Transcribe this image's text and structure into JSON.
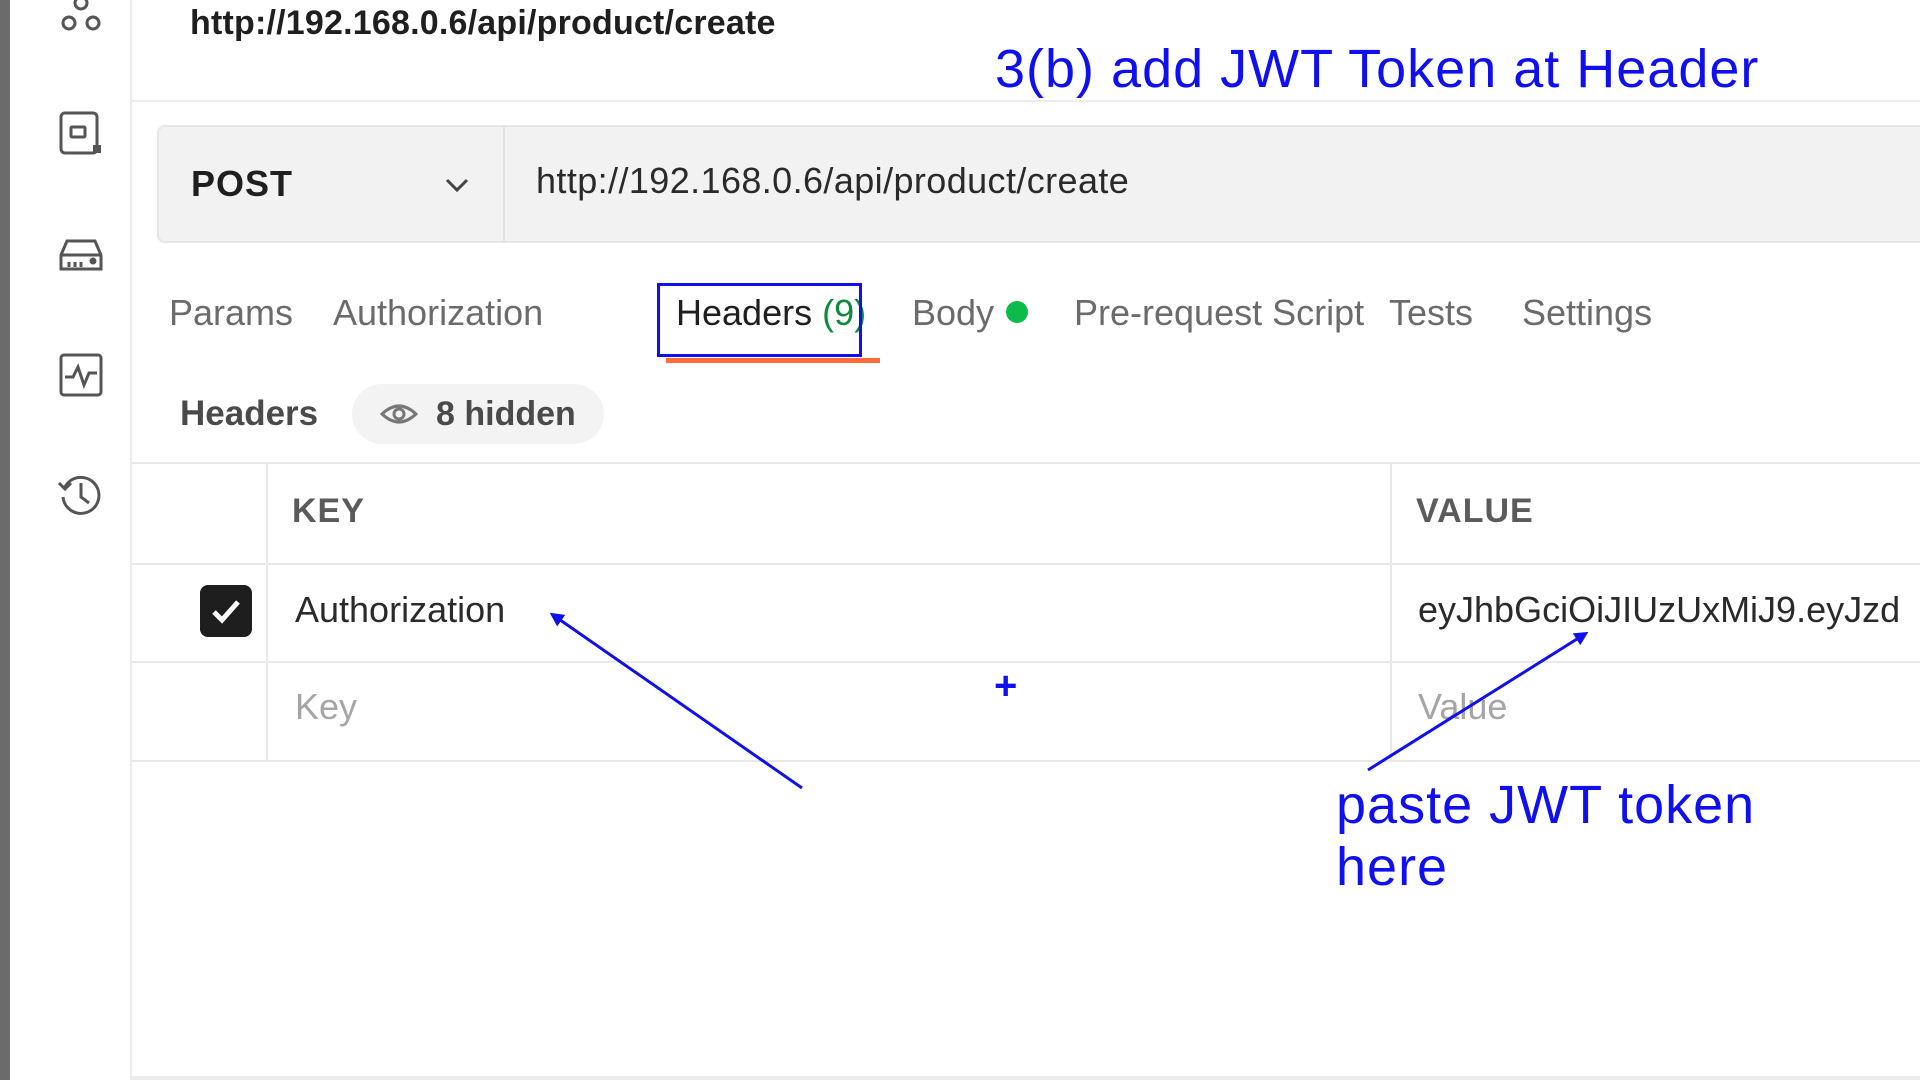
{
  "request": {
    "title": "http://192.168.0.6/api/product/create",
    "method": "POST",
    "url": "http://192.168.0.6/api/product/create"
  },
  "tabs": {
    "params": "Params",
    "authorization": "Authorization",
    "headers": "Headers",
    "headers_count": "(9)",
    "body": "Body",
    "pre_request": "Pre-request Script",
    "tests": "Tests",
    "settings": "Settings"
  },
  "headers_panel": {
    "label": "Headers",
    "hidden": "8 hidden",
    "col_key": "KEY",
    "col_value": "VALUE",
    "rows": [
      {
        "key": "Authorization",
        "value": "eyJhbGciOiJIUzUxMiJ9.eyJzd",
        "checked": true
      }
    ],
    "new_key_placeholder": "Key",
    "new_value_placeholder": "Value"
  },
  "annotations": {
    "title": "3(b) add JWT Token at Header",
    "plus": "+",
    "paste_line1": "paste JWT token",
    "paste_line2": "here",
    "color": "#1010ee"
  },
  "colors": {
    "active_tab_underline": "#ff6c37",
    "headers_count": "#0b8a3e",
    "body_dot": "#0cbc4a"
  },
  "sidebar": {
    "icons": [
      "apis-icon",
      "environments-icon",
      "mock-servers-icon",
      "monitors-icon",
      "history-icon"
    ]
  }
}
